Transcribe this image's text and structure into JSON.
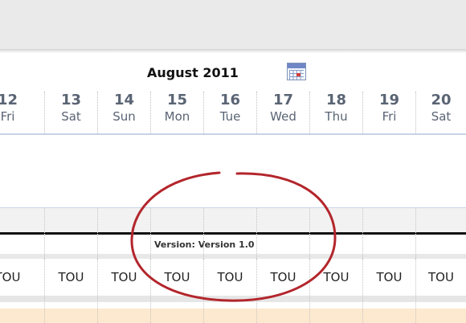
{
  "header": {
    "month_title": "August 2011"
  },
  "days": [
    {
      "num": "12",
      "name": "Fri"
    },
    {
      "num": "13",
      "name": "Sat"
    },
    {
      "num": "14",
      "name": "Sun"
    },
    {
      "num": "15",
      "name": "Mon"
    },
    {
      "num": "16",
      "name": "Tue"
    },
    {
      "num": "17",
      "name": "Wed"
    },
    {
      "num": "18",
      "name": "Thu"
    },
    {
      "num": "19",
      "name": "Fri"
    },
    {
      "num": "20",
      "name": "Sat"
    }
  ],
  "version": {
    "label": "Version: Version 1.0"
  },
  "tou_cells": [
    "TOU",
    "TOU",
    "TOU",
    "TOU",
    "TOU",
    "TOU",
    "TOU",
    "TOU",
    "TOU"
  ],
  "colors": {
    "toolbar": "#eaeaea",
    "day_text": "#5a6474",
    "annotation": "#b3262c",
    "peach": "#fde9cf"
  },
  "icons": {
    "calendar": "calendar-icon"
  }
}
